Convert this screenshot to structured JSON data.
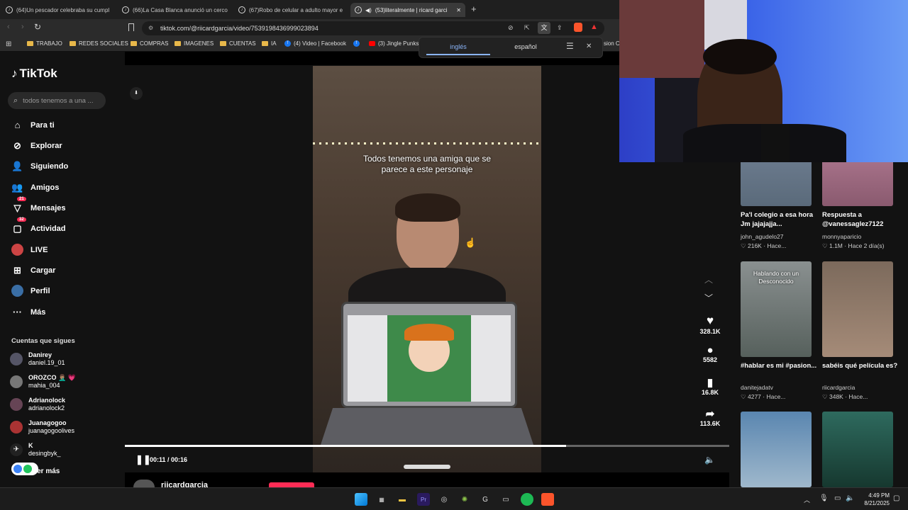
{
  "tabs": [
    {
      "label": "(64)Un pescador celebraba su cumpl"
    },
    {
      "label": "(66)La Casa Blanca anunció un cerco"
    },
    {
      "label": "(67)Robo de celular a adulto mayor e"
    },
    {
      "label": "(53)literalmente | ricard garci"
    }
  ],
  "url": "tiktok.com/@riicardgarcia/video/7539198436999023894",
  "bookmarks": [
    {
      "label": "TRABAJO"
    },
    {
      "label": "REDES SOCIALES"
    },
    {
      "label": "COMPRAS"
    },
    {
      "label": "IMAGENES"
    },
    {
      "label": "CUENTAS"
    },
    {
      "label": "IA"
    },
    {
      "label": "(4) Video | Facebook"
    },
    {
      "label": ""
    },
    {
      "label": "(3) Jingle Punks"
    }
  ],
  "translate": {
    "source": "inglés",
    "target": "español"
  },
  "bookmarks_overflow": "sion C",
  "sidebar": {
    "logo": "TikTok",
    "search_placeholder": "todos tenemos a una ...",
    "items": [
      {
        "label": "Para ti",
        "icon": "home-icon"
      },
      {
        "label": "Explorar",
        "icon": "compass-icon"
      },
      {
        "label": "Siguiendo",
        "icon": "following-icon"
      },
      {
        "label": "Amigos",
        "icon": "friends-icon"
      },
      {
        "label": "Mensajes",
        "icon": "messages-icon",
        "badge": "21"
      },
      {
        "label": "Actividad",
        "icon": "activity-icon",
        "badge": "32"
      },
      {
        "label": "LIVE",
        "icon": "live-icon"
      },
      {
        "label": "Cargar",
        "icon": "upload-icon"
      },
      {
        "label": "Perfil",
        "icon": "profile-icon"
      },
      {
        "label": "Más",
        "icon": "more-icon"
      }
    ],
    "following_title": "Cuentas que sigues",
    "accounts": [
      {
        "name": "Danirey",
        "user": "daniel.19_01"
      },
      {
        "name": "OROZCO 🤦🏽‍♂️ 💗",
        "user": "mahia_004"
      },
      {
        "name": "Adrianolock",
        "user": "adrianolock2"
      },
      {
        "name": "Juanagogoo",
        "user": "juanagogoolives"
      },
      {
        "name": "K",
        "user": "desingbyk_"
      }
    ],
    "see_more": "Ver más"
  },
  "video": {
    "caption": "Todos tenemos una amiga que se parece a este personaje",
    "time": "00:11 / 00:16",
    "progress": 0.73,
    "author": "riicardgarcia"
  },
  "actions": {
    "likes": "328.1K",
    "comments": "5582",
    "saves": "16.8K",
    "shares": "113.6K"
  },
  "recommended": [
    {
      "title": "Pa'l colegio a esa hora Jm jajajajja...",
      "user": "john_agudelo27",
      "likes": "216K",
      "time": "Hace..."
    },
    {
      "title": "Respuesta a @vanessaglez7122",
      "user": "monnyaparicio",
      "likes": "1.1M",
      "time": "Hace 2 día(s)"
    },
    {
      "title": "#hablar es mi #pasion...",
      "user": "danitejadatv",
      "likes": "4277",
      "time": "Hace...",
      "overlay": "Hablando con un Desconocido"
    },
    {
      "title": "sabéis qué película es?",
      "user": "riicardgarcia",
      "likes": "348K",
      "time": "Hace..."
    }
  ],
  "clock": {
    "time": "4:49 PM",
    "date": "8/21/2025"
  },
  "colors": {
    "brand": "#fe2c55",
    "bg": "#121212"
  }
}
